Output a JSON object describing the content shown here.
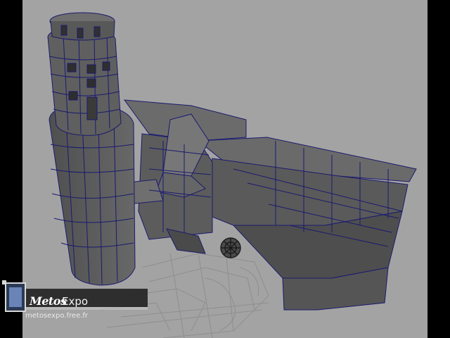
{
  "watermark": {
    "logo_text": "Metos",
    "suffix_text": "Expo",
    "url": "metosexpo.free.fr"
  },
  "icons": {
    "logo_emblem": "monitor-emblem-icon"
  },
  "colors": {
    "viewport_bg": "#a3a3a3",
    "mesh_face": "#5d5d5d",
    "mesh_edge": "#1a1a6e",
    "wireframe": "#8a8a8a",
    "frame": "#000000"
  }
}
